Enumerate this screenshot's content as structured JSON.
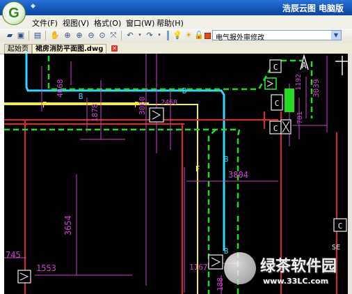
{
  "app": {
    "title": "浩辰云图 电脑版",
    "logo_letter": "G",
    "system_menu_glyph": "◆"
  },
  "menubar": [
    "文件(F)",
    "视图(V)",
    "格式(O)",
    "窗口(W)",
    "帮助(H)"
  ],
  "toolbar": {
    "layer_select_value": "电气报外审修改",
    "layer_color": "#e04a1a"
  },
  "tabs": {
    "start": "起始页",
    "file": "裙房消防平面图.dwg",
    "close_glyph": "✕"
  },
  "drawing": {
    "dimensions": [
      "4068",
      "1878",
      "3060",
      "2468",
      "1192",
      "3039",
      "781",
      "3804",
      "3654",
      "745",
      "1553",
      "1167",
      "188"
    ],
    "labels": {
      "pipe_b": "B",
      "pipe_f": "F",
      "equipment_c": "C",
      "se": "SE",
      "axis_a": "A"
    },
    "colors": {
      "background": "#000000",
      "cyan": "#33d6ff",
      "green": "#22dd22",
      "yellow": "#f2ee3a",
      "red": "#e02828",
      "magenta": "#d040d0",
      "white": "#f0f0f0"
    }
  },
  "watermark": {
    "brand": "绿茶软件园",
    "url": "www.33LC.com"
  }
}
